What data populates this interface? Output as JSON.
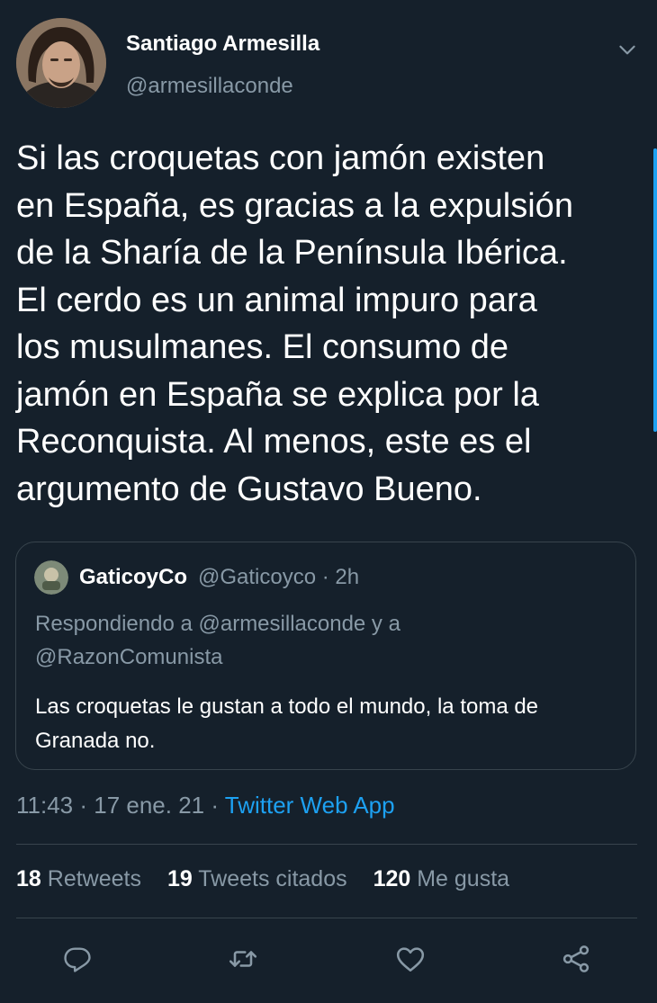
{
  "tweet": {
    "author_name": "Santiago Armesilla",
    "author_handle": "@armesillaconde",
    "text": "Si las croquetas con jamón existen\nen España, es gracias a la expulsión\nde la Sharía de la Península Ibérica.\nEl cerdo es un animal impuro para\nlos musulmanes. El consumo de\njamón en España se explica por la\nReconquista. Al menos, este es el\nargumento de Gustavo Bueno.",
    "time": "11:43 · 17 ene. 21 · ",
    "source": "Twitter Web App"
  },
  "quoted": {
    "name": "GaticoyCo",
    "handle_time": "@Gaticoyco · 2h",
    "reply_prefix": "Respondiendo a ",
    "reply_to_1": "@armesillaconde",
    "reply_and": " y a",
    "reply_to_2": "@RazonComunista",
    "text": "Las croquetas le gustan a todo el mundo, la toma de Granada no."
  },
  "stats": {
    "retweets_count": "18",
    "retweets_label": " Retweets",
    "quotes_count": "19",
    "quotes_label": " Tweets citados",
    "likes_count": "120",
    "likes_label": " Me gusta"
  },
  "icons": {
    "more": "chevron-down-icon",
    "reply": "reply-icon",
    "retweet": "retweet-icon",
    "like": "heart-icon",
    "share": "share-icon"
  },
  "colors": {
    "background": "#15202b",
    "text": "#ffffff",
    "muted": "#8899a6",
    "accent": "#1da1f2",
    "border": "#38444d"
  }
}
